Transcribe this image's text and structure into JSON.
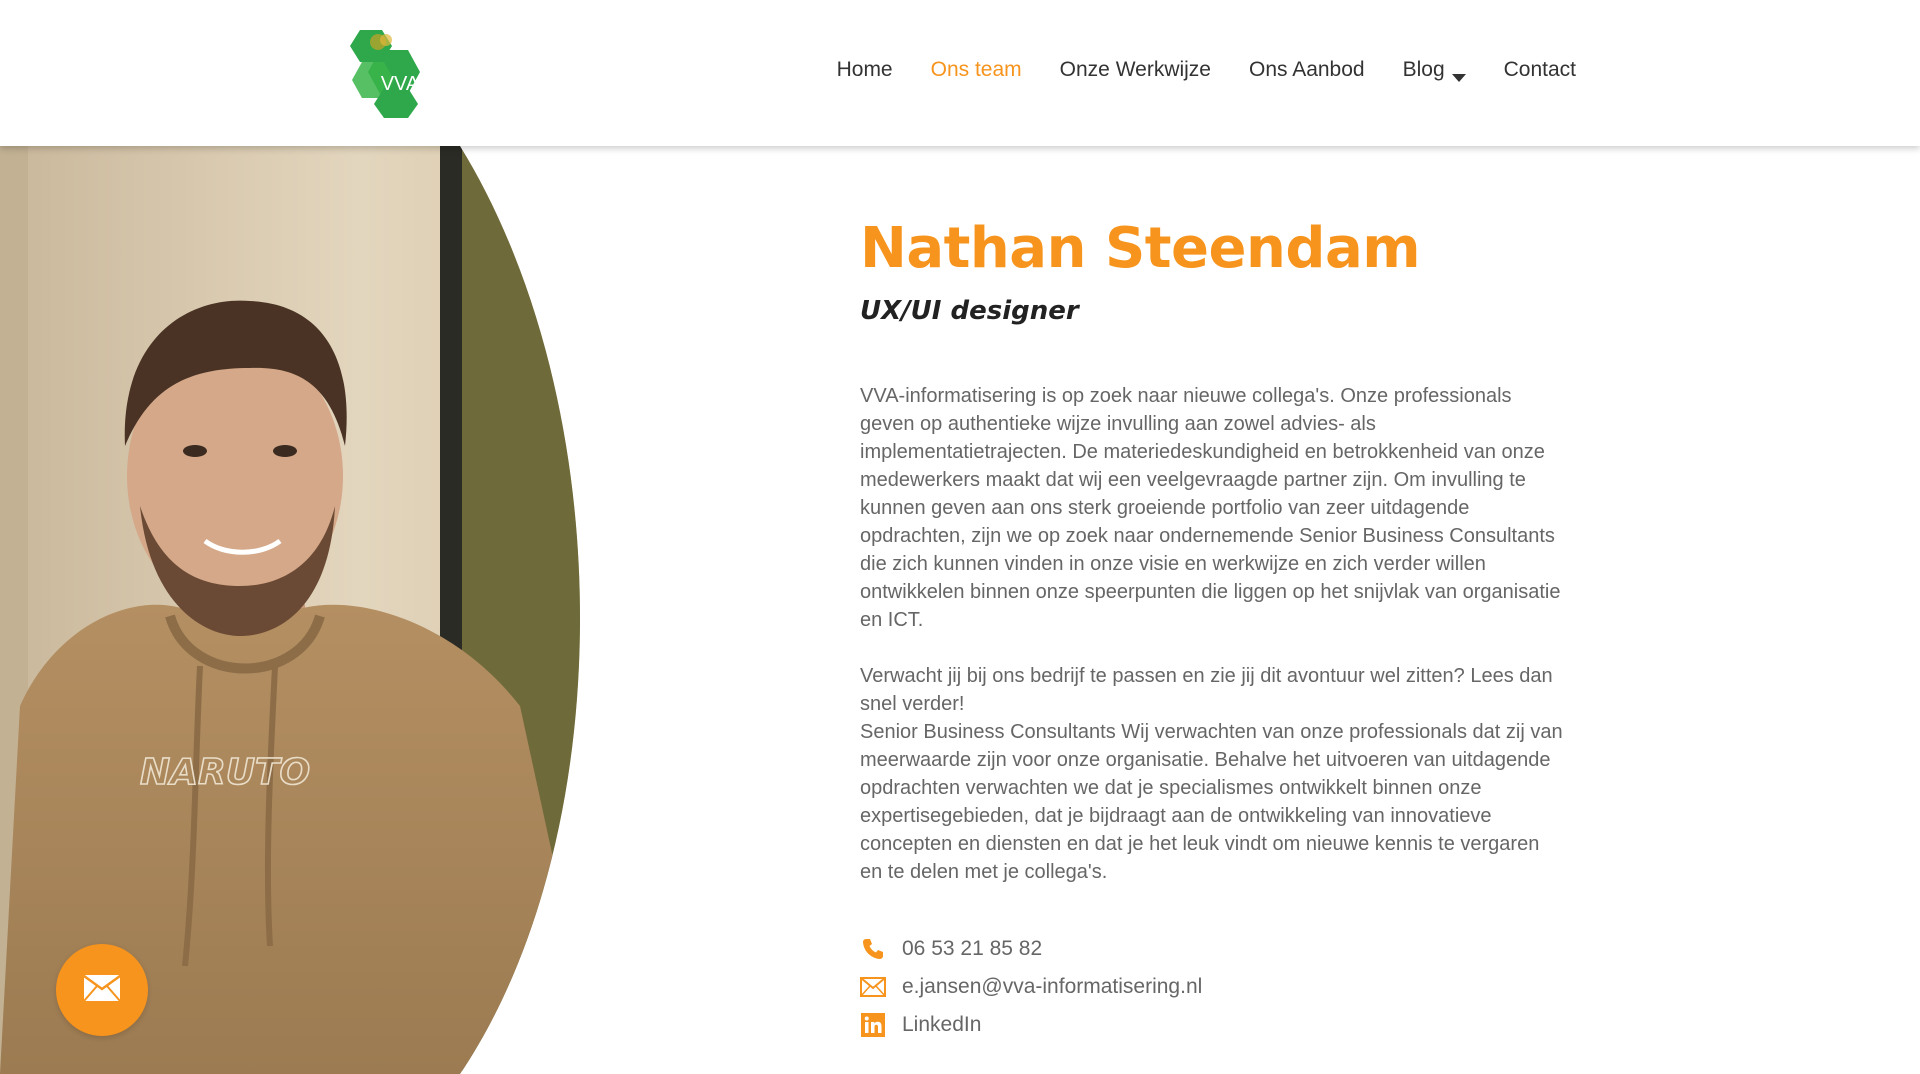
{
  "brand": {
    "logo_text": "VVA",
    "accent_color": "#F7941D",
    "logo_green": "#2EA84A"
  },
  "nav": {
    "items": [
      {
        "label": "Home",
        "active": false
      },
      {
        "label": "Ons team",
        "active": true
      },
      {
        "label": "Onze Werkwijze",
        "active": false
      },
      {
        "label": "Ons Aanbod",
        "active": false
      },
      {
        "label": "Blog",
        "active": false,
        "has_dropdown": true
      },
      {
        "label": "Contact",
        "active": false
      }
    ]
  },
  "profile": {
    "name": "Nathan Steendam",
    "role": "UX/UI designer",
    "paragraph_1": "VVA-informatisering is op zoek naar nieuwe collega's. Onze professionals geven op authentieke wijze invulling aan zowel advies- als implementatietrajecten. De materiedeskundigheid en betrokkenheid van onze medewerkers maakt dat wij een veelgevraagde partner zijn. Om invulling te kunnen geven aan ons sterk groeiende portfolio van zeer uitdagende opdrachten, zijn we op zoek naar ondernemende Senior Business Consultants die zich kunnen vinden in onze visie en werkwijze en zich verder willen ontwikkelen binnen onze speerpunten die liggen op het snijvlak van organisatie en ICT.",
    "paragraph_2a": "Verwacht jij bij ons bedrijf te passen en zie jij dit avontuur wel zitten? Lees dan snel verder!",
    "paragraph_2b": "Senior Business Consultants Wij verwachten van onze professionals dat zij van meerwaarde zijn voor onze organisatie. Behalve het uitvoeren van uitdagende opdrachten verwachten we dat je specialismes ontwikkelt binnen onze expertisegebieden, dat je bijdraagt aan de ontwikkeling van innovatieve concepten en diensten en dat je het leuk vindt om nieuwe kennis te vergaren en te delen met je collega's."
  },
  "contact": {
    "phone": "06 53 21 85 82",
    "email": "e.jansen@vva-informatisering.nl",
    "linkedin": "LinkedIn",
    "icons": [
      "phone-icon",
      "mail-icon",
      "linkedin-icon"
    ]
  },
  "photo": {
    "hoodie_print": "NARUTO"
  },
  "fab": {
    "icon": "mail-icon"
  }
}
